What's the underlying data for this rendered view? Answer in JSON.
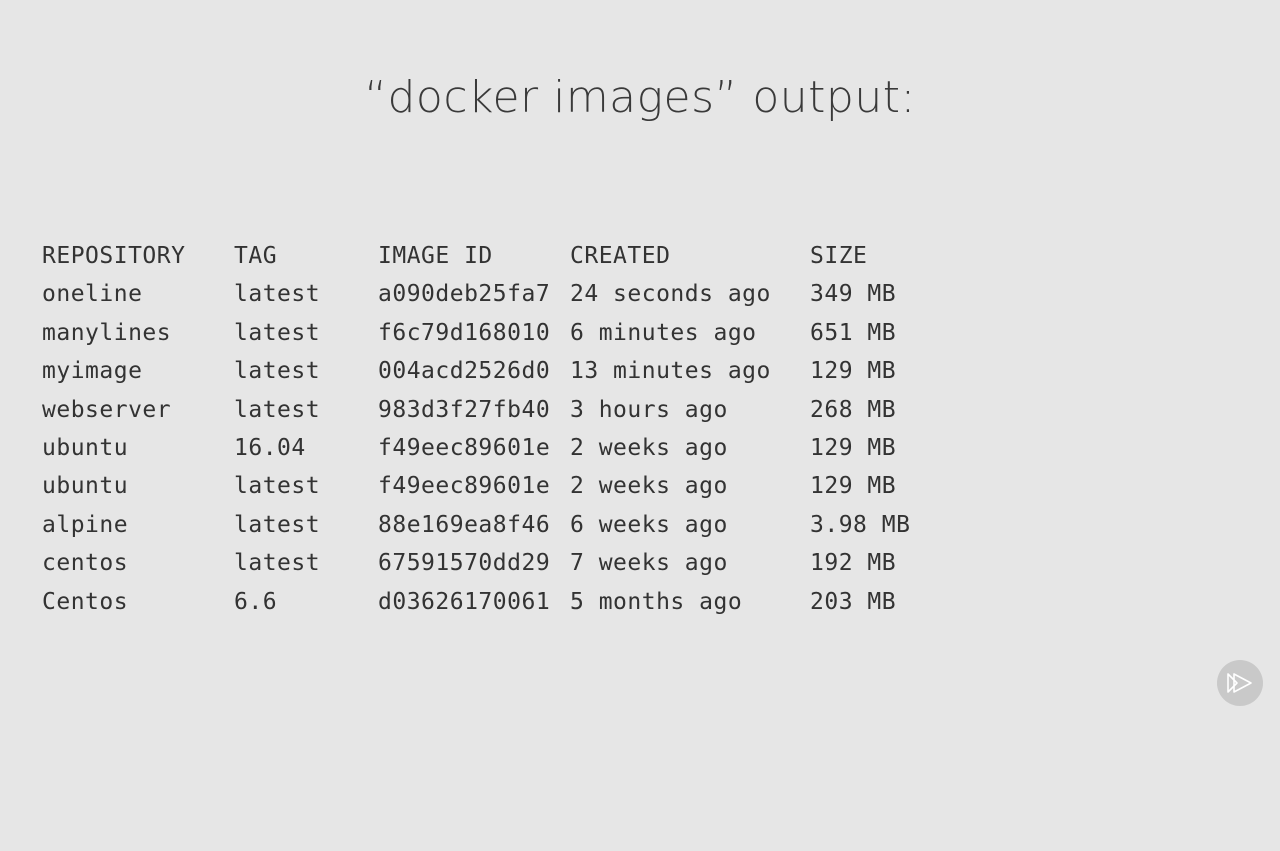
{
  "slide": {
    "title": "“docker images” output:"
  },
  "table": {
    "headers": {
      "repository": "REPOSITORY",
      "tag": "TAG",
      "image_id": "IMAGE ID",
      "created": "CREATED",
      "size": "SIZE"
    },
    "rows": [
      {
        "repository": "oneline",
        "tag": "latest",
        "image_id": "a090deb25fa7",
        "created": "24 seconds ago",
        "size": "349 MB"
      },
      {
        "repository": "manylines",
        "tag": "latest",
        "image_id": "f6c79d168010",
        "created": "6 minutes ago",
        "size": "651 MB"
      },
      {
        "repository": "myimage",
        "tag": "latest",
        "image_id": "004acd2526d0",
        "created": "13 minutes ago",
        "size": "129 MB"
      },
      {
        "repository": "webserver",
        "tag": "latest",
        "image_id": "983d3f27fb40",
        "created": "3 hours ago",
        "size": "268 MB"
      },
      {
        "repository": "ubuntu",
        "tag": "16.04",
        "image_id": "f49eec89601e",
        "created": "2 weeks ago",
        "size": "129 MB"
      },
      {
        "repository": "ubuntu",
        "tag": "latest",
        "image_id": "f49eec89601e",
        "created": "2 weeks ago",
        "size": "129 MB"
      },
      {
        "repository": "alpine",
        "tag": "latest",
        "image_id": "88e169ea8f46",
        "created": "6 weeks ago",
        "size": "3.98 MB"
      },
      {
        "repository": "centos",
        "tag": "latest",
        "image_id": "67591570dd29",
        "created": "7 weeks ago",
        "size": "192 MB"
      },
      {
        "repository": "Centos",
        "tag": "6.6",
        "image_id": "d03626170061",
        "created": "5 months ago",
        "size": "203 MB"
      }
    ]
  },
  "branding": {
    "icon": "play-logo-icon"
  }
}
